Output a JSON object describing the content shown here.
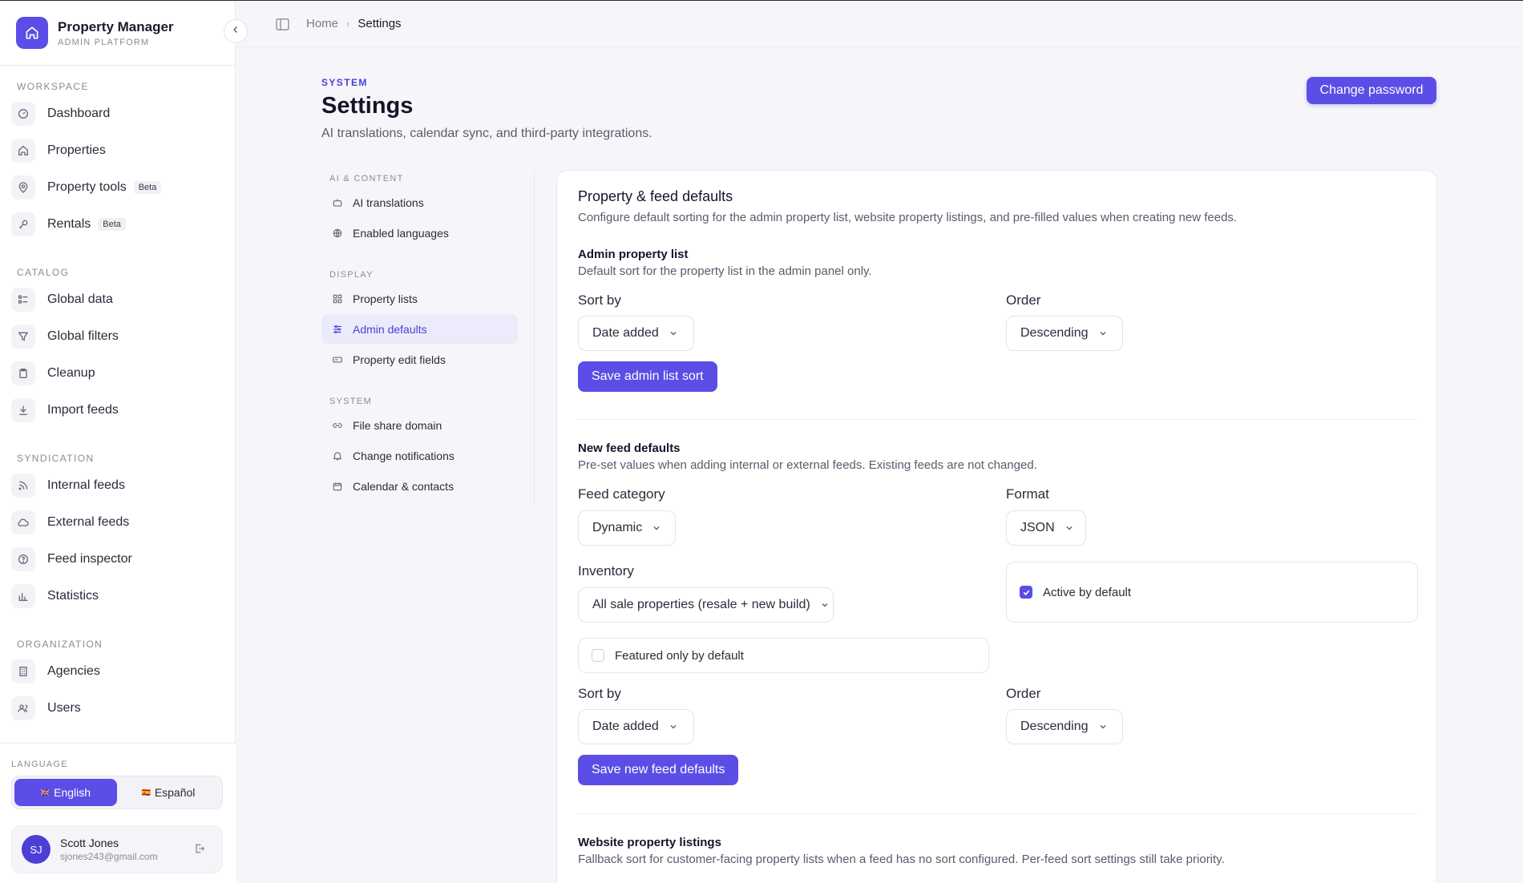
{
  "brand": {
    "title": "Property Manager",
    "subtitle": "ADMIN PLATFORM"
  },
  "sidebar": {
    "workspace": {
      "label": "WORKSPACE",
      "items": [
        {
          "label": "Dashboard",
          "icon": "gauge-icon"
        },
        {
          "label": "Properties",
          "icon": "home-icon"
        },
        {
          "label": "Property tools",
          "icon": "map-pin-icon",
          "badge": "Beta"
        },
        {
          "label": "Rentals",
          "icon": "key-icon",
          "badge": "Beta"
        }
      ]
    },
    "catalog": {
      "label": "CATALOG",
      "items": [
        {
          "label": "Global data",
          "icon": "list-icon"
        },
        {
          "label": "Global filters",
          "icon": "filter-icon"
        },
        {
          "label": "Cleanup",
          "icon": "clipboard-icon"
        },
        {
          "label": "Import feeds",
          "icon": "download-icon"
        }
      ]
    },
    "syndication": {
      "label": "SYNDICATION",
      "items": [
        {
          "label": "Internal feeds",
          "icon": "rss-icon"
        },
        {
          "label": "External feeds",
          "icon": "cloud-icon"
        },
        {
          "label": "Feed inspector",
          "icon": "help-circle-icon"
        },
        {
          "label": "Statistics",
          "icon": "bar-chart-icon"
        }
      ]
    },
    "organization": {
      "label": "ORGANIZATION",
      "items": [
        {
          "label": "Agencies",
          "icon": "building-icon"
        },
        {
          "label": "Users",
          "icon": "users-icon"
        }
      ]
    }
  },
  "language": {
    "label": "LANGUAGE",
    "english": "English",
    "spanish": "Español",
    "selected": "English"
  },
  "user": {
    "name": "Scott Jones",
    "email": "sjones243@gmail.com",
    "initials": "SJ"
  },
  "breadcrumb": {
    "home": "Home",
    "current": "Settings"
  },
  "header": {
    "eyebrow": "SYSTEM",
    "title": "Settings",
    "subtitle": "AI translations, calendar sync, and third-party integrations.",
    "change_password": "Change password"
  },
  "settings_nav": {
    "ai_content": {
      "label": "AI & CONTENT",
      "items": [
        {
          "label": "AI translations",
          "icon": "robot-icon"
        },
        {
          "label": "Enabled languages",
          "icon": "globe-icon"
        }
      ]
    },
    "display": {
      "label": "DISPLAY",
      "items": [
        {
          "label": "Property lists",
          "icon": "grid-icon"
        },
        {
          "label": "Admin defaults",
          "icon": "sliders-icon",
          "active": true
        },
        {
          "label": "Property edit fields",
          "icon": "form-icon"
        }
      ]
    },
    "system": {
      "label": "SYSTEM",
      "items": [
        {
          "label": "File share domain",
          "icon": "link-icon"
        },
        {
          "label": "Change notifications",
          "icon": "bell-icon"
        },
        {
          "label": "Calendar & contacts",
          "icon": "calendar-icon"
        }
      ]
    }
  },
  "card": {
    "title": "Property & feed defaults",
    "description": "Configure default sorting for the admin property list, website property listings, and pre-filled values when creating new feeds.",
    "admin_list": {
      "title": "Admin property list",
      "description": "Default sort for the property list in the admin panel only.",
      "sort_label": "Sort by",
      "sort_value": "Date added",
      "order_label": "Order",
      "order_value": "Descending",
      "save": "Save admin list sort"
    },
    "new_feed": {
      "title": "New feed defaults",
      "description": "Pre-set values when adding internal or external feeds. Existing feeds are not changed.",
      "category_label": "Feed category",
      "category_value": "Dynamic",
      "format_label": "Format",
      "format_value": "JSON",
      "inventory_label": "Inventory",
      "inventory_value": "All sale properties (resale + new build)",
      "active_label": "Active by default",
      "active_checked": true,
      "featured_label": "Featured only by default",
      "featured_checked": false,
      "sort_label": "Sort by",
      "sort_value": "Date added",
      "order_label": "Order",
      "order_value": "Descending",
      "save": "Save new feed defaults"
    },
    "website_listings": {
      "title": "Website property listings",
      "description": "Fallback sort for customer-facing property lists when a feed has no sort configured. Per-feed sort settings still take priority."
    }
  },
  "colors": {
    "accent": "#5a4ee6",
    "accent_soft": "#ecebfb",
    "page_bg": "#f6f6fa"
  }
}
